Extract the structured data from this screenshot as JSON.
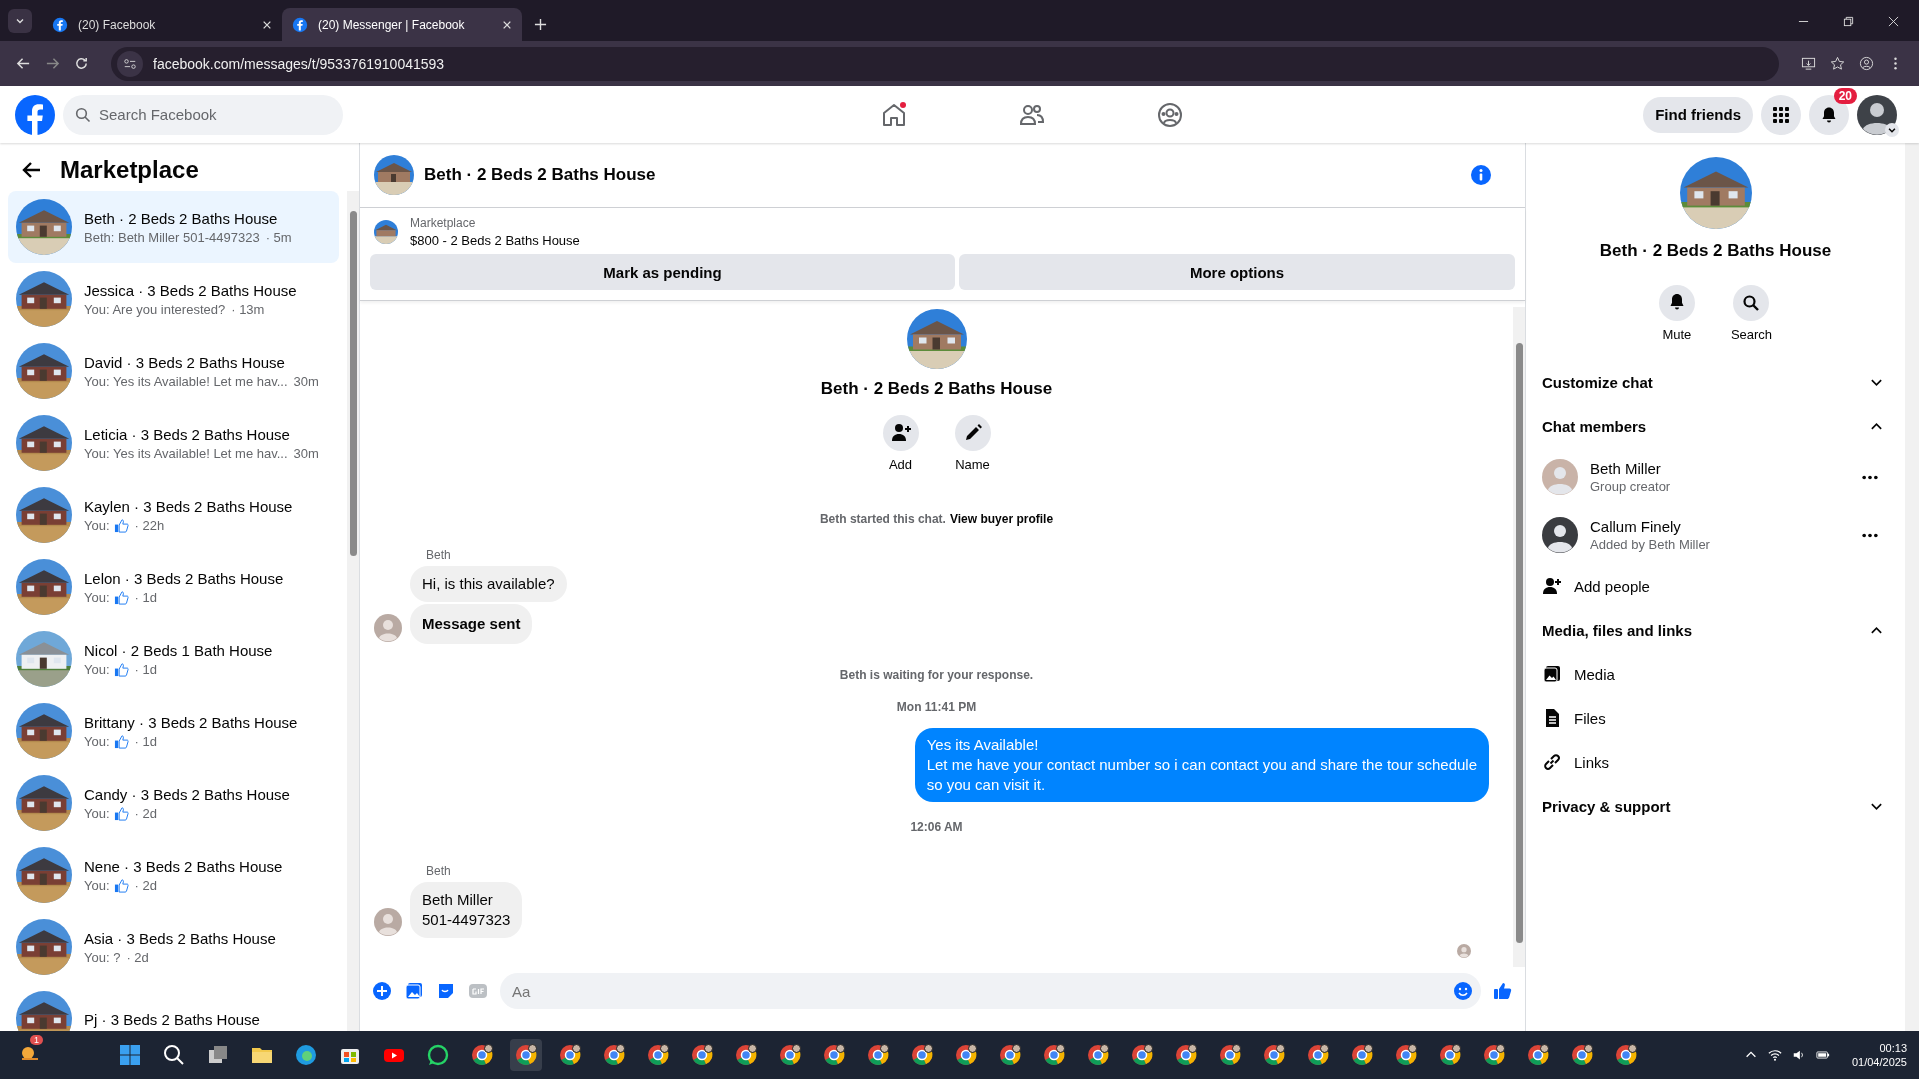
{
  "browser": {
    "tabs": [
      {
        "title": "(20) Facebook",
        "selected": false
      },
      {
        "title": "(20) Messenger | Facebook",
        "selected": true
      }
    ],
    "url": "facebook.com/messages/t/9533761910041593"
  },
  "header": {
    "search": {
      "placeholder": "Search Facebook"
    },
    "find_friends": "Find friends",
    "notification_count": "20"
  },
  "sidebar": {
    "title": "Marketplace",
    "items": [
      {
        "title": "Beth · 2 Beds 2 Baths House",
        "kind": "text",
        "preview": "Beth: Beth Miller 501-4497323",
        "time": "· 5m",
        "selected": true
      },
      {
        "title": "Jessica · 3 Beds 2 Baths House",
        "kind": "text",
        "preview": "You: Are you interested?",
        "time": "· 13m",
        "selected": false
      },
      {
        "title": "David · 3 Beds 2 Baths House",
        "kind": "text",
        "preview": "You: Yes its Available! Let me hav...",
        "time": "30m",
        "selected": false
      },
      {
        "title": "Leticia · 3 Beds 2 Baths House",
        "kind": "text",
        "preview": "You: Yes its Available! Let me hav...",
        "time": "30m",
        "selected": false
      },
      {
        "title": "Kaylen · 3 Beds 2 Baths House",
        "kind": "like",
        "preview": "You:",
        "time": "· 22h",
        "selected": false
      },
      {
        "title": "Lelon · 3 Beds 2 Baths House",
        "kind": "like",
        "preview": "You:",
        "time": "· 1d",
        "selected": false
      },
      {
        "title": "Nicol · 2 Beds 1 Bath House",
        "kind": "like",
        "preview": "You:",
        "time": "· 1d",
        "selected": false
      },
      {
        "title": "Brittany · 3 Beds 2 Baths House",
        "kind": "like",
        "preview": "You:",
        "time": "· 1d",
        "selected": false
      },
      {
        "title": "Candy · 3 Beds 2 Baths House",
        "kind": "like",
        "preview": "You:",
        "time": "· 2d",
        "selected": false
      },
      {
        "title": "Nene · 3 Beds 2 Baths House",
        "kind": "like",
        "preview": "You:",
        "time": "· 2d",
        "selected": false
      },
      {
        "title": "Asia · 3 Beds 2 Baths House",
        "kind": "text",
        "preview": "You: ?",
        "time": "· 2d",
        "selected": false
      },
      {
        "title": "Pj · 3 Beds 2 Baths House",
        "kind": "cut",
        "selected": false
      }
    ]
  },
  "chat": {
    "title": "Beth · 2 Beds 2 Baths House",
    "listing": {
      "label": "Marketplace",
      "name": "$800 - 2 Beds 2 Baths House"
    },
    "actions": [
      "Mark as pending",
      "More options"
    ],
    "intro": {
      "title": "Beth · 2 Beds 2 Baths House",
      "buttons": [
        "Add",
        "Name"
      ]
    },
    "messages": [
      {
        "kind": "system",
        "text": "Beth started this chat.",
        "link": "View buyer profile"
      },
      {
        "kind": "sender",
        "text": "Beth"
      },
      {
        "kind": "incoming",
        "lines": [
          "Hi, is this available?"
        ],
        "bold": false,
        "avatar": false
      },
      {
        "kind": "incoming",
        "lines": [
          "Message sent"
        ],
        "bold": true,
        "avatar": true
      },
      {
        "kind": "system",
        "text": "Beth is waiting for your response."
      },
      {
        "kind": "time",
        "text": "Mon 11:41 PM"
      },
      {
        "kind": "outgoing",
        "lines": [
          "Yes its Available!",
          "Let me have your contact number so i can contact you and share the tour schedule",
          "so you can visit it."
        ]
      },
      {
        "kind": "time",
        "text": "12:06 AM"
      },
      {
        "kind": "sender",
        "text": "Beth"
      },
      {
        "kind": "incoming",
        "lines": [
          "Beth Miller",
          "501-4497323"
        ],
        "bold": false,
        "avatar": true
      }
    ],
    "composer": {
      "placeholder": "Aa"
    }
  },
  "details": {
    "title": "Beth · 2 Beds 2 Baths House",
    "actions": [
      "Mute",
      "Search"
    ],
    "sections": [
      {
        "title": "Customize chat",
        "expanded": false
      },
      {
        "title": "Chat members",
        "expanded": true,
        "members": [
          {
            "name": "Beth Miller",
            "role": "Group creator"
          },
          {
            "name": "Callum Finely",
            "role": "Added by Beth Miller"
          }
        ],
        "add": "Add people"
      },
      {
        "title": "Media, files and links",
        "expanded": true,
        "links": [
          {
            "kind": "media",
            "label": "Media"
          },
          {
            "kind": "files",
            "label": "Files"
          },
          {
            "kind": "links",
            "label": "Links"
          }
        ]
      },
      {
        "title": "Privacy & support",
        "expanded": false
      }
    ]
  },
  "taskbar": {
    "badge": "1",
    "time": "00:13",
    "date": "01/04/2025"
  }
}
